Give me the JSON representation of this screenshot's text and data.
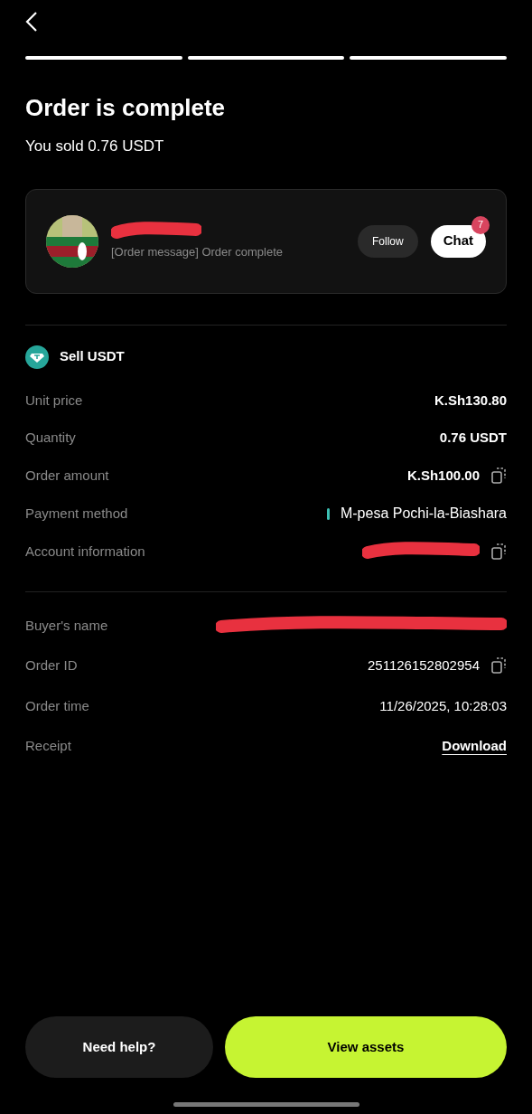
{
  "progress": [
    {
      "completed": true
    },
    {
      "completed": true
    },
    {
      "completed": true
    }
  ],
  "title": "Order is complete",
  "subtitle": "You sold 0.76 USDT",
  "counterparty": {
    "message": "[Order message] Order complete",
    "follow": "Follow",
    "chat": "Chat",
    "chat_badge": "7"
  },
  "asset": {
    "label": "Sell USDT"
  },
  "details": [
    {
      "kind": "plain",
      "label": "Unit price",
      "value": "K.Sh130.80"
    },
    {
      "kind": "plain",
      "label": "Quantity",
      "value": "0.76 USDT"
    },
    {
      "kind": "copy",
      "label": "Order amount",
      "value": "K.Sh100.00"
    },
    {
      "kind": "method",
      "label": "Payment method",
      "value": "M-pesa Pochi-la-Biashara",
      "color": "#3cc0b4"
    },
    {
      "kind": "redacted_copy",
      "label": "Account information"
    }
  ],
  "party": [
    {
      "kind": "redacted_link",
      "label": "Buyer's name"
    },
    {
      "kind": "copy_plain",
      "label": "Order ID",
      "value": "251126152802954"
    },
    {
      "kind": "plain_regular",
      "label": "Order time",
      "value": "11/26/2025, 10:28:03"
    },
    {
      "kind": "download",
      "label": "Receipt",
      "value": "Download"
    }
  ],
  "buttons": {
    "help": "Need help?",
    "assets": "View assets"
  }
}
